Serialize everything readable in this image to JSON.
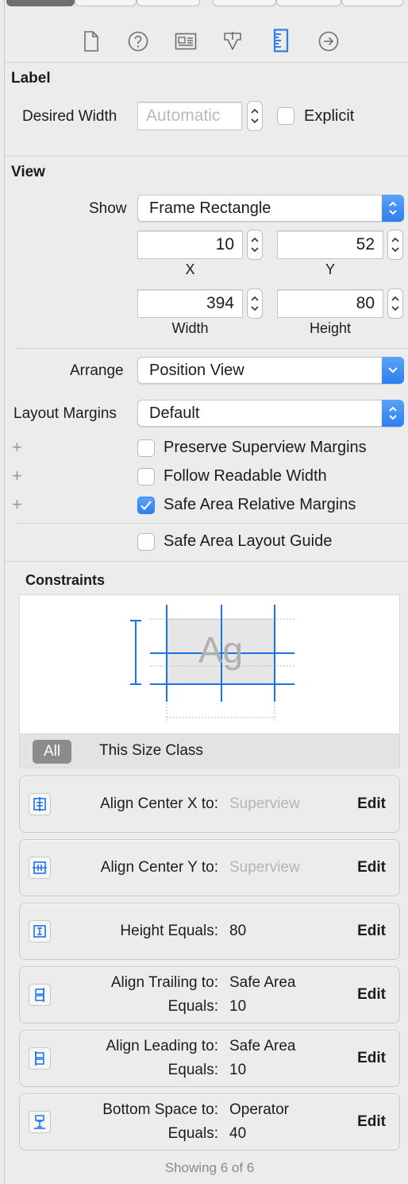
{
  "colors": {
    "accent": "#2d7ef0",
    "constraint_blue": "#1a73e8",
    "placeholder": "#b9b9b9"
  },
  "toolbar": {
    "icons": [
      "file-icon",
      "help-icon",
      "identity-icon",
      "attributes-icon",
      "size-ruler-icon",
      "connections-arrow-icon"
    ],
    "active": "size-ruler-icon"
  },
  "label_section": {
    "title": "Label",
    "desired_width_label": "Desired Width",
    "desired_width_placeholder": "Automatic",
    "explicit_label": "Explicit",
    "explicit_checked": false
  },
  "view_section": {
    "title": "View",
    "show_label": "Show",
    "show_value": "Frame Rectangle",
    "x_value": "10",
    "y_value": "52",
    "x_label": "X",
    "y_label": "Y",
    "width_value": "394",
    "height_value": "80",
    "width_label": "Width",
    "height_label": "Height",
    "arrange_label": "Arrange",
    "arrange_value": "Position View",
    "layout_margins_label": "Layout Margins",
    "layout_margins_value": "Default",
    "plus": "+",
    "checkboxes": [
      {
        "label": "Preserve Superview Margins",
        "checked": false
      },
      {
        "label": "Follow Readable Width",
        "checked": false
      },
      {
        "label": "Safe Area Relative Margins",
        "checked": true
      },
      {
        "label": "Safe Area Layout Guide",
        "checked": false
      }
    ]
  },
  "constraints": {
    "title": "Constraints",
    "preview_text": "Ag",
    "segments": [
      "All",
      "This Size Class"
    ],
    "selected_segment": "All",
    "edit_label": "Edit",
    "rows": [
      {
        "icon": "align-center-x-icon",
        "key1": "Align Center X to:",
        "val1": "Superview",
        "muted": true
      },
      {
        "icon": "align-center-y-icon",
        "key1": "Align Center Y to:",
        "val1": "Superview",
        "muted": true
      },
      {
        "icon": "height-icon",
        "key1": "Height Equals:",
        "val1": "80",
        "muted": false
      },
      {
        "icon": "align-trailing-icon",
        "key1": "Align Trailing to:",
        "val1": "Safe Area",
        "key2": "Equals:",
        "val2": "10",
        "muted": false
      },
      {
        "icon": "align-leading-icon",
        "key1": "Align Leading to:",
        "val1": "Safe Area",
        "key2": "Equals:",
        "val2": "10",
        "muted": false
      },
      {
        "icon": "bottom-space-icon",
        "key1": "Bottom Space to:",
        "val1": "Operator",
        "key2": "Equals:",
        "val2": "40",
        "muted": false
      }
    ],
    "showing": "Showing 6 of 6"
  }
}
